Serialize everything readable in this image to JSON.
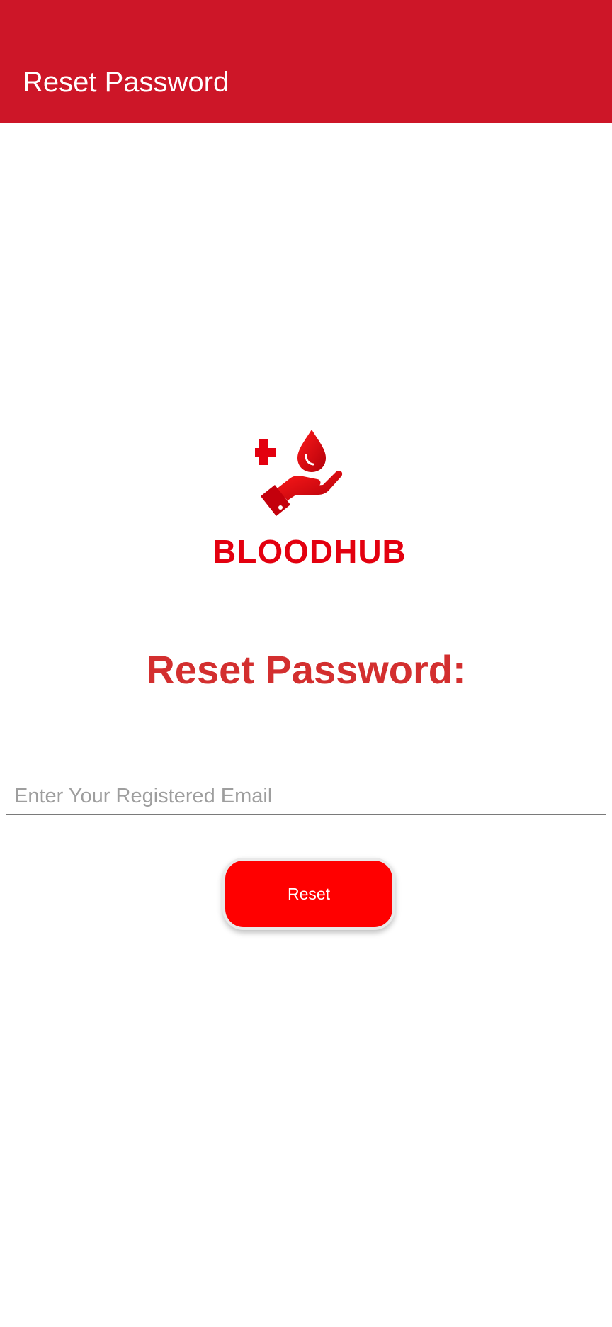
{
  "app_bar": {
    "title": "Reset Password",
    "color": "#cd1628"
  },
  "logo": {
    "icon": "hand-blood-drop-cross-icon",
    "text": "BLOODHUB",
    "color": "#e3000f"
  },
  "heading": {
    "text": "Reset Password:",
    "color": "#d32f2f"
  },
  "email_input": {
    "value": "",
    "placeholder": "Enter Your Registered Email"
  },
  "reset_button": {
    "label": "Reset",
    "color": "#ff0000"
  }
}
